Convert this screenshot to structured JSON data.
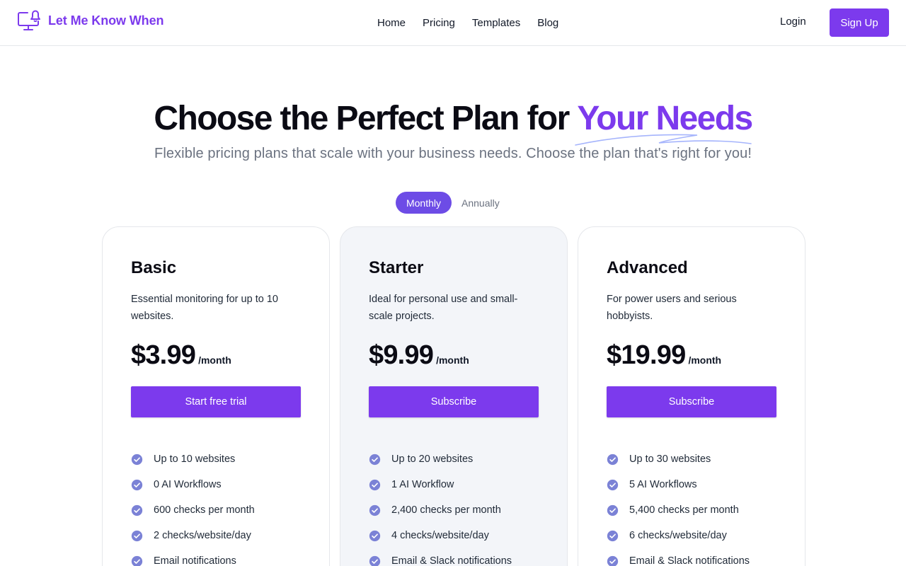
{
  "brand": {
    "name": "Let Me Know When",
    "accent": "#7c3aed"
  },
  "nav": {
    "items": [
      "Home",
      "Pricing",
      "Templates",
      "Blog"
    ]
  },
  "auth": {
    "login": "Login",
    "signup": "Sign Up"
  },
  "hero": {
    "title_main": "Choose the Perfect Plan for ",
    "title_accent": "Your Needs",
    "subtitle": "Flexible pricing plans that scale with your business needs. Choose the plan that's right for you!"
  },
  "billing_toggle": {
    "monthly": "Monthly",
    "annually": "Annually",
    "selected": "Monthly"
  },
  "plans": [
    {
      "name": "Basic",
      "description": "Essential monitoring for up to 10 websites.",
      "price": "$3.99",
      "period": "/month",
      "cta": "Start free trial",
      "featured": false,
      "features": [
        "Up to 10 websites",
        "0 AI Workflows",
        "600 checks per month",
        "2 checks/website/day",
        "Email notifications"
      ]
    },
    {
      "name": "Starter",
      "description": "Ideal for personal use and small-scale projects.",
      "price": "$9.99",
      "period": "/month",
      "cta": "Subscribe",
      "featured": true,
      "features": [
        "Up to 20 websites",
        "1 AI Workflow",
        "2,400 checks per month",
        "4 checks/website/day",
        "Email & Slack notifications"
      ]
    },
    {
      "name": "Advanced",
      "description": "For power users and serious hobbyists.",
      "price": "$19.99",
      "period": "/month",
      "cta": "Subscribe",
      "featured": false,
      "features": [
        "Up to 30 websites",
        "5 AI Workflows",
        "5,400 checks per month",
        "6 checks/website/day",
        "Email & Slack notifications"
      ]
    }
  ]
}
